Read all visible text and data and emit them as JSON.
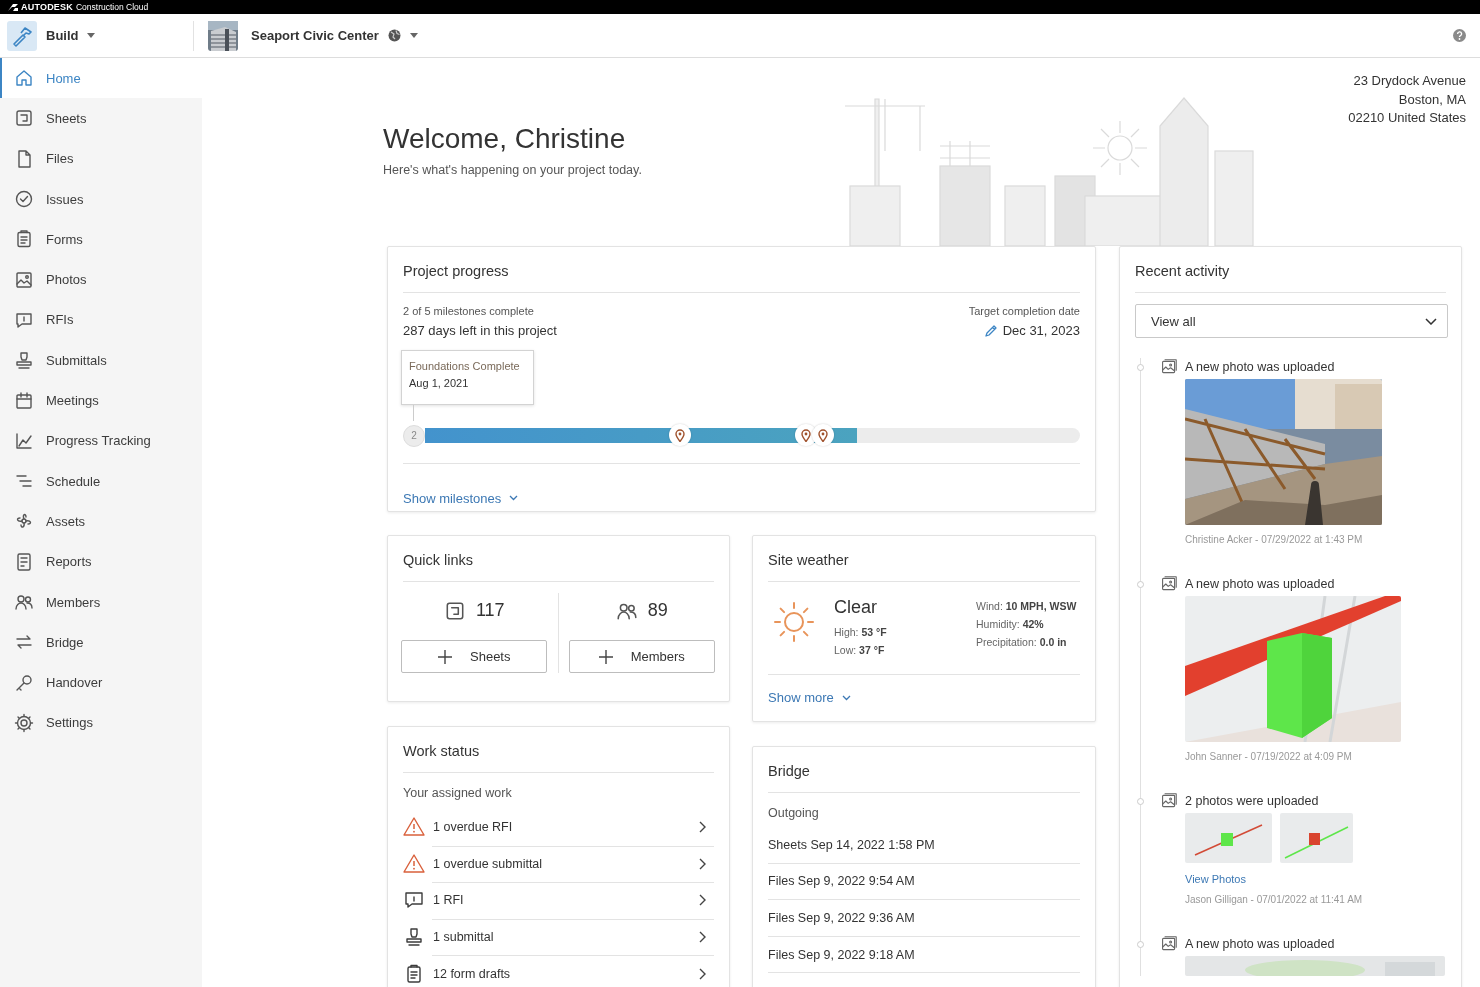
{
  "brand": {
    "logo": "AUTODESK",
    "product": "Construction Cloud"
  },
  "header": {
    "app": "Build",
    "project": "Seaport Civic Center"
  },
  "sidebar": {
    "items": [
      {
        "label": "Home",
        "selected": true
      },
      {
        "label": "Sheets",
        "selected": false
      },
      {
        "label": "Files",
        "selected": false
      },
      {
        "label": "Issues",
        "selected": false
      },
      {
        "label": "Forms",
        "selected": false
      },
      {
        "label": "Photos",
        "selected": false
      },
      {
        "label": "RFIs",
        "selected": false
      },
      {
        "label": "Submittals",
        "selected": false
      },
      {
        "label": "Meetings",
        "selected": false
      },
      {
        "label": "Progress Tracking",
        "selected": false
      },
      {
        "label": "Schedule",
        "selected": false
      },
      {
        "label": "Assets",
        "selected": false
      },
      {
        "label": "Reports",
        "selected": false
      },
      {
        "label": "Members",
        "selected": false
      },
      {
        "label": "Bridge",
        "selected": false
      },
      {
        "label": "Handover",
        "selected": false
      },
      {
        "label": "Settings",
        "selected": false
      }
    ]
  },
  "welcome": {
    "title": "Welcome, Christine",
    "subtitle": "Here's what's happening on your project today."
  },
  "address": [
    "23 Drydock Avenue",
    "Boston, MA",
    "02210 United States"
  ],
  "project_progress": {
    "title": "Project progress",
    "milestones_summary": "2 of 5 milestones complete",
    "days_left": "287 days left in this project",
    "target_label": "Target completion date",
    "target_date": "Dec 31, 2023",
    "tooltip": {
      "title": "Foundations Complete",
      "date": "Aug 1, 2021"
    },
    "start_marker": "2",
    "level": 0.659,
    "markers": [
      {
        "level": 0.39
      },
      {
        "level": 0.582
      },
      {
        "level": 0.607
      }
    ],
    "toggle": "Show milestones"
  },
  "quick_links": {
    "title": "Quick links",
    "links": [
      {
        "count": "117",
        "button": "Sheets"
      },
      {
        "count": "89",
        "button": "Members"
      }
    ]
  },
  "site_weather": {
    "title": "Site weather",
    "condition": "Clear",
    "temps": [
      "High: **53 °F**",
      "Low: **37 °F**"
    ],
    "details": [
      "Wind: **10 MPH, WSW**",
      "Humidity: **42%**",
      "Precipitation: **0.0 in**"
    ],
    "toggle": "Show more"
  },
  "work_status": {
    "title": "Work status",
    "subtitle": "Your assigned work",
    "items": [
      {
        "label": "1 overdue RFI",
        "kind": "warning"
      },
      {
        "label": "1 overdue submittal",
        "kind": "warning"
      },
      {
        "label": "1 RFI",
        "kind": "rfi"
      },
      {
        "label": "1 submittal",
        "kind": "submittal"
      },
      {
        "label": "12 form drafts",
        "kind": "form"
      }
    ]
  },
  "bridge": {
    "title": "Bridge",
    "section": "Outgoing",
    "items": [
      "Sheets Sep 14, 2022 1:58 PM",
      "Files Sep 9, 2022 9:54 AM",
      "Files Sep 9, 2022 9:36 AM",
      "Files Sep 9, 2022 9:18 AM"
    ]
  },
  "recent_activity": {
    "title": "Recent activity",
    "filter": "View all",
    "entries": [
      {
        "text": "A new photo was uploaded",
        "byline": "Christine Acker - 07/29/2022 at 1:43 PM"
      },
      {
        "text": "A new photo was uploaded",
        "byline": "John Sanner - 07/19/2022 at 4:09 PM"
      },
      {
        "text": "2 photos were uploaded",
        "link": "View Photos",
        "byline": "Jason Gilligan - 07/01/2022 at 11:41 AM"
      },
      {
        "text": "A new photo was uploaded"
      }
    ]
  }
}
